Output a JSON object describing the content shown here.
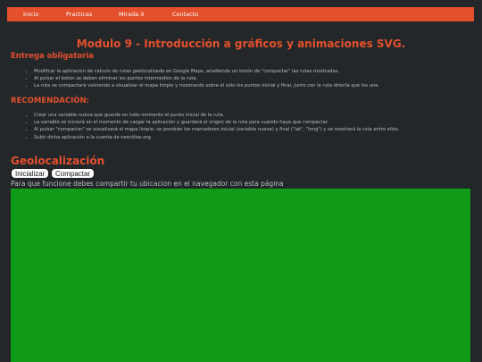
{
  "nav": {
    "items": [
      "Inicio",
      "Practicas",
      "Mirada X",
      "Contacto"
    ]
  },
  "page_title": "Modulo 9 - Introducción a gráficos y animaciones SVG.",
  "sections": {
    "obligatoria": {
      "heading": "Entrega obligatoria",
      "items": [
        "Modificar la aplicación de calculo de rutas geolocalizada en Google Maps, añadiendo un botón de \"compactar\" las rutas mostradas.",
        "Al pulsar el boton se deben eliminar los puntos intermedios de la ruta.",
        "La ruta se compactará volviendo a visualizar el mapa limpio y mostrando sobre él solo los puntos inicial y final, junto con la ruta directa que los une."
      ]
    },
    "recomendacion": {
      "heading": "RECOMENDACIÓN:",
      "items": [
        "Crear una variable nueva que guarde en todo momento el punto inicial de la ruta.",
        "La variable se iniciará en el momento de cargar la aplicación y guardará el origen de la ruta para cuando haya que compactar.",
        "Al pulsar \"compactar\" se visualizará el mapa limpio, se pondrán los marcadores inicial (variable nueva) y final (\"lat\", \"long\") y se mostrará la ruta entre ellos.",
        "Subir dicha aplicación a la cuenta de neocities.org"
      ]
    }
  },
  "geo": {
    "heading": "Geolocalización",
    "init_button": "Inicializar",
    "compact_button": "Compactar",
    "hint": "Para que funcione debes compartir tu ubicacion en el navegador con esta página"
  },
  "colors": {
    "accent": "#e4502b",
    "background": "#23272a",
    "map": "#109b18"
  }
}
